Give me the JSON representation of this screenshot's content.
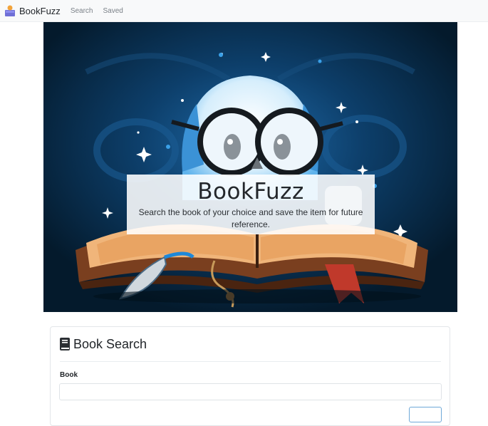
{
  "navbar": {
    "brand": "BookFuzz",
    "links": [
      {
        "label": "Search"
      },
      {
        "label": "Saved"
      }
    ]
  },
  "hero": {
    "title": "BookFuzz",
    "subtitle": "Search the book of your choice and save the item for future reference."
  },
  "search_card": {
    "title": "Book Search",
    "field_label": "Book",
    "input_value": ""
  },
  "colors": {
    "navbar_bg": "#f8f9fa",
    "hero_bg": "#062238",
    "accent_blue": "#6ea8d8"
  },
  "icons": {
    "brand": "books-logo-icon",
    "card": "book-icon"
  }
}
